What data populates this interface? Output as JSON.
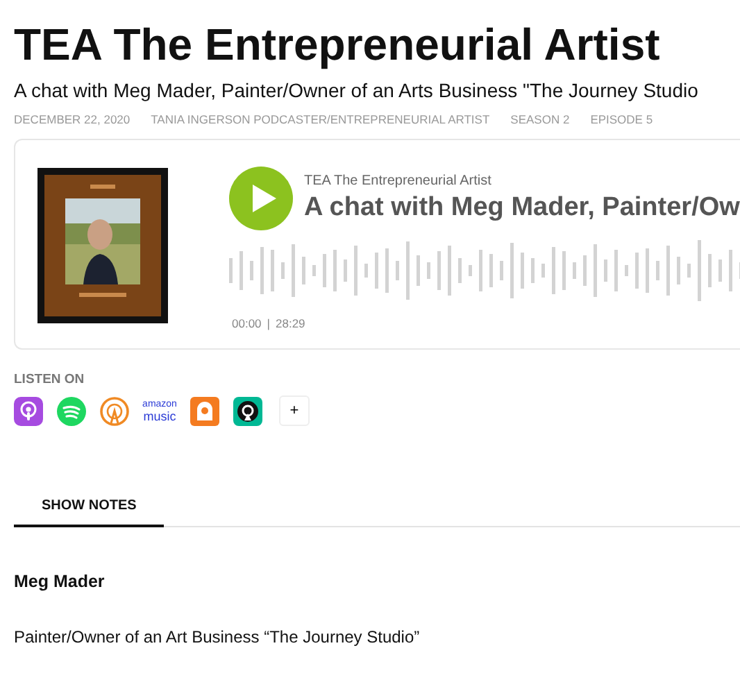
{
  "title": "TEA The Entrepreneurial Artist",
  "subtitle": "A chat with Meg Mader, Painter/Owner of an Arts Business \"The Journey Studio",
  "meta": [
    "DECEMBER 22, 2020",
    "TANIA INGERSON PODCASTER/ENTREPRENEURIAL ARTIST",
    "SEASON 2",
    "EPISODE 5"
  ],
  "player": {
    "show": "TEA The Entrepreneurial Artist",
    "episode": "A chat with Meg Mader, Painter/Ow",
    "elapsed": "00:00",
    "separator": "|",
    "duration": "28:29"
  },
  "listen_on": {
    "label": "LISTEN ON",
    "platforms": [
      {
        "kind": "apple"
      },
      {
        "kind": "spotify"
      },
      {
        "kind": "overcast"
      },
      {
        "kind": "amazon",
        "lines": [
          "amazon",
          "music"
        ]
      },
      {
        "kind": "castbox"
      },
      {
        "kind": "castro"
      },
      {
        "kind": "more",
        "text": "+"
      }
    ]
  },
  "tabs": [
    {
      "label": "SHOW NOTES",
      "selected": true
    }
  ],
  "notes": {
    "heading": "Meg Mader",
    "paragraph": "Painter/Owner of an Art Business “The Journey Studio”"
  }
}
